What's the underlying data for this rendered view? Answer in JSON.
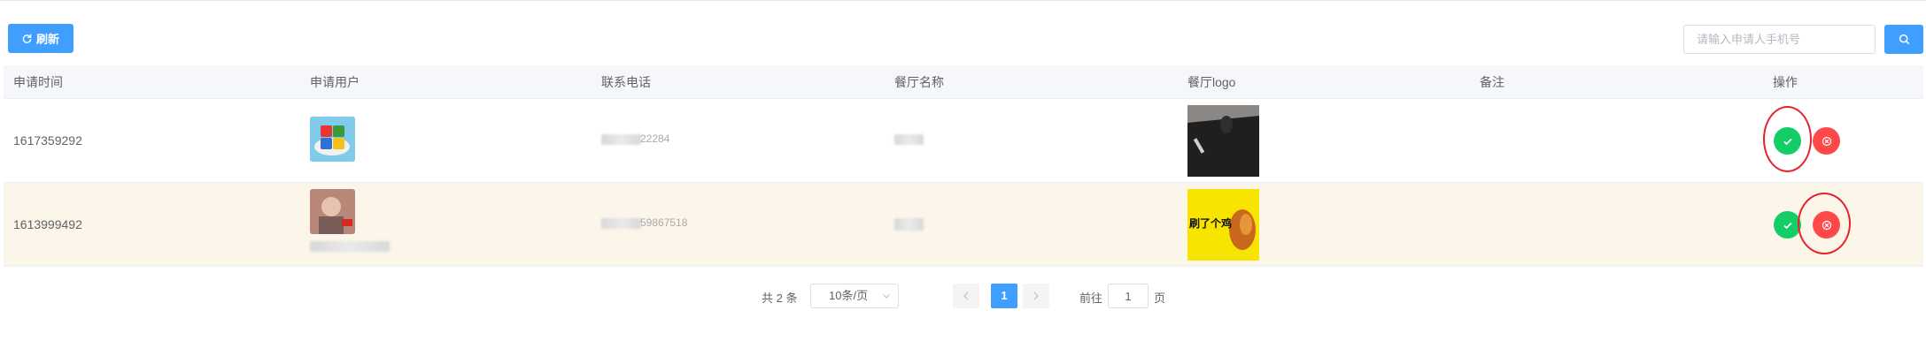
{
  "toolbar": {
    "refresh_label": "刷新",
    "search_placeholder": "请输入申请人手机号"
  },
  "table": {
    "columns": [
      "申请时间",
      "申请用户",
      "联系电话",
      "餐厅名称",
      "餐厅logo",
      "备注",
      "操作"
    ],
    "rows": [
      {
        "time": "1617359292",
        "phone_visible": "22284"
      },
      {
        "time": "1613999492",
        "phone_visible": "59867518"
      }
    ]
  },
  "logo2_text": "刷了个鸡",
  "pagination": {
    "total_text": "共 2 条",
    "page_size": "10条/页",
    "current_page": "1",
    "goto_label": "前往",
    "goto_value": "1",
    "goto_suffix": "页"
  },
  "colors": {
    "primary": "#409eff",
    "approve": "#13ce66",
    "reject": "#ff4949",
    "annotation": "#e4232b"
  }
}
